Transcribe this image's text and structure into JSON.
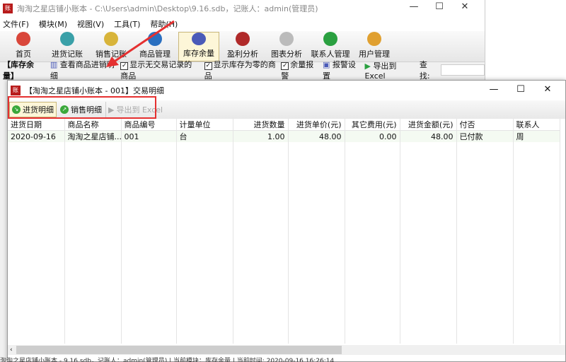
{
  "main": {
    "title": "淘淘之星店铺小账本 - C:\\Users\\admin\\Desktop\\9.16.sdb，记账人：admin(管理员)",
    "icon_text": "账",
    "menu": [
      "文件(F)",
      "模块(M)",
      "视图(V)",
      "工具(T)",
      "帮助(H)"
    ],
    "toolbar": [
      {
        "label": "首页",
        "color": "#d9463a"
      },
      {
        "label": "进货记账",
        "color": "#3aa0a8"
      },
      {
        "label": "销售记账",
        "color": "#d8b43a"
      },
      {
        "label": "商品管理",
        "color": "#2a6fc0"
      },
      {
        "label": "库存余量",
        "color": "#4a5ab8",
        "active": true
      },
      {
        "label": "盈利分析",
        "color": "#b02a2a"
      },
      {
        "label": "图表分析",
        "color": "#bbbbbb"
      },
      {
        "label": "联系人管理",
        "color": "#2aa040"
      },
      {
        "label": "用户管理",
        "color": "#e0a030"
      }
    ],
    "sub": {
      "module": "【库存余量】",
      "view_detail": "查看商品进销明细",
      "chk1": "显示无交易记录的商品",
      "chk2": "显示库存为零的商品",
      "chk3": "余量报警",
      "alarm": "报警设置",
      "export": "导出到 Excel",
      "find": "查找:"
    }
  },
  "child": {
    "title": "【淘淘之星店铺小账本 - 001】交易明细",
    "icon_text": "账",
    "buttons": {
      "purchase": "进货明细",
      "sales": "销售明细",
      "export": "导出到 Excel"
    },
    "columns": [
      "进货日期",
      "商品名称",
      "商品编号",
      "计量单位",
      "进货数量",
      "进货单价(元)",
      "其它费用(元)",
      "进货金额(元)",
      "付否",
      "联系人"
    ],
    "rows": [
      [
        "2020-09-16",
        "淘淘之星店铺...",
        "001",
        "台",
        "1.00",
        "48.00",
        "0.00",
        "48.00",
        "已付款",
        "周"
      ]
    ]
  },
  "status": {
    "text": "淘淘之星店铺小账本 - 9.16.sdb，记账人：admin(管理员) | 当前模块：库存余量 | 当前时间: 2020-09-16 16:26:14"
  },
  "colors": {
    "annotation": "#e53030",
    "active_bg": "#fdf6d8"
  }
}
